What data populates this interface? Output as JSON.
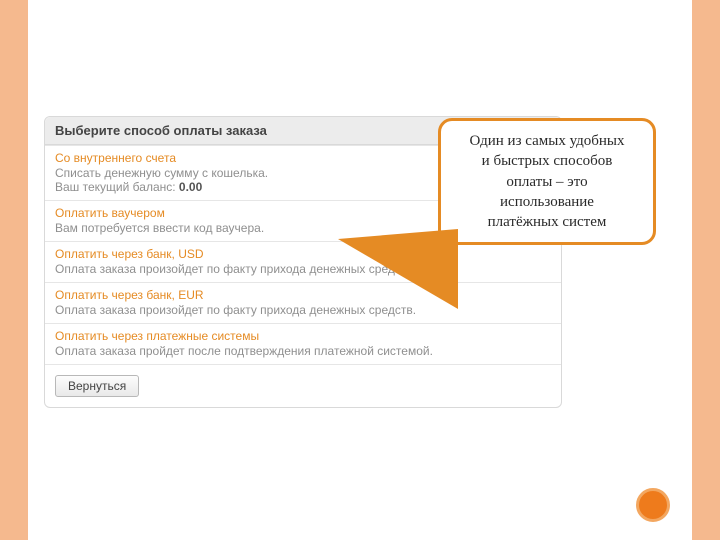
{
  "panel": {
    "header": "Выберите способ оплаты заказа",
    "options": [
      {
        "title": "Со внутреннего счета",
        "desc_prefix": "Списать денежную сумму с кошелька.\nВаш текущий баланс: ",
        "balance": "0.00"
      },
      {
        "title": "Оплатить ваучером",
        "desc": "Вам потребуется ввести код ваучера."
      },
      {
        "title": "Оплатить через банк, USD",
        "desc": "Оплата заказа произойдет по факту прихода денежных средств."
      },
      {
        "title": "Оплатить через банк, EUR",
        "desc": "Оплата заказа произойдет по факту прихода денежных средств."
      },
      {
        "title": "Оплатить через платежные системы",
        "desc": "Оплата заказа пройдет после подтверждения платежной системой."
      }
    ],
    "back_label": "Вернуться"
  },
  "callout": {
    "line1": "Один из самых удобных",
    "line2": "и быстрых способов",
    "line3": "оплаты – это",
    "line4": "использование",
    "line5": "платёжных систем"
  },
  "colors": {
    "accent": "#e58b24",
    "stripe": "#f5b98e"
  }
}
